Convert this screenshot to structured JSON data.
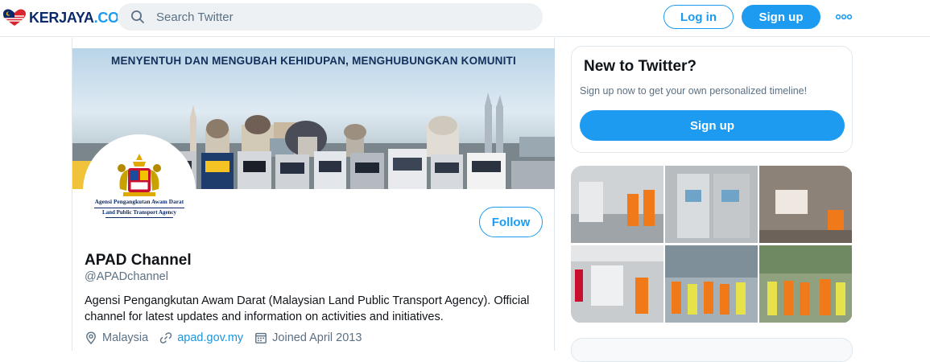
{
  "header": {
    "logo_text": "KERJAYA",
    "logo_suffix": ".CO",
    "search_placeholder": "Search Twitter",
    "login_label": "Log in",
    "signup_label": "Sign up",
    "more_icon": "more-dots-icon"
  },
  "banner": {
    "slogan": "MENYENTUH DAN MENGUBAH KEHIDUPAN, MENGHUBUNGKAN KOMUNITI"
  },
  "avatar": {
    "line1": "Agensi Pengangkutan Awam Darat",
    "line2": "Land Public Transport Agency"
  },
  "profile": {
    "follow_label": "Follow",
    "name": "APAD Channel",
    "handle": "@APADchannel",
    "bio": "Agensi Pengangkutan Awam Darat (Malaysian Land Public Transport Agency). Official channel for latest updates and information on activities and initiatives.",
    "location": "Malaysia",
    "website": "apad.gov.my",
    "joined": "Joined April 2013"
  },
  "sidebar": {
    "new_title": "New to Twitter?",
    "new_subtitle": "Sign up now to get your own personalized timeline!",
    "signup_label": "Sign up"
  },
  "colors": {
    "accent": "#1d9bf0",
    "text_secondary": "#5b7083",
    "brand_navy": "#0b2a6b"
  }
}
